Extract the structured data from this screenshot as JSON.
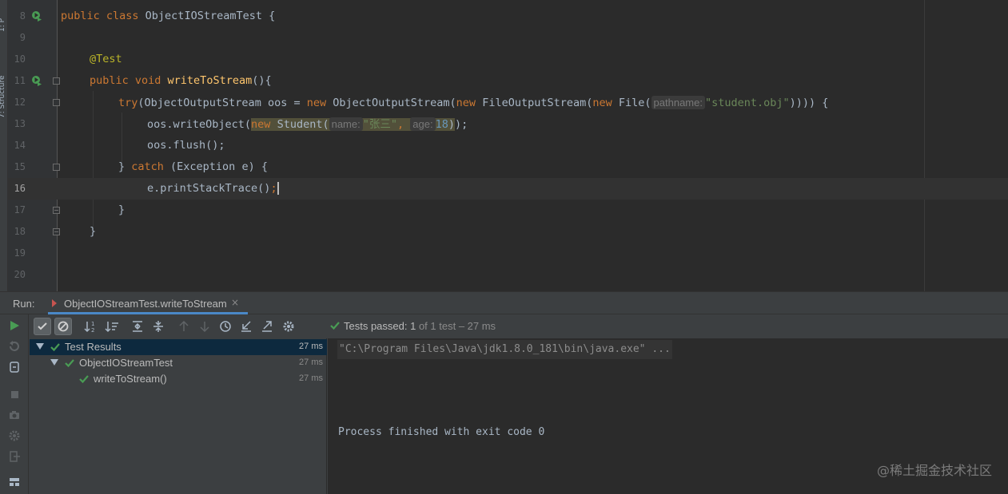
{
  "side_strip": {
    "labels": [
      "1: P",
      "7: Structure"
    ]
  },
  "editor": {
    "lines": [
      {
        "num": "8"
      },
      {
        "num": "9"
      },
      {
        "num": "10"
      },
      {
        "num": "11"
      },
      {
        "num": "12"
      },
      {
        "num": "13"
      },
      {
        "num": "14"
      },
      {
        "num": "15"
      },
      {
        "num": "16"
      },
      {
        "num": "17"
      },
      {
        "num": "18"
      },
      {
        "num": "19"
      },
      {
        "num": "20"
      }
    ],
    "tokens": {
      "l8_kw": "public class ",
      "l8_rest": "ObjectIOStreamTest {",
      "l10_anno": "@Test",
      "l11_kw": "public void ",
      "l11_fn": "writeToStream",
      "l11_rest": "(){",
      "l12_try": "try",
      "l12_a": "(ObjectOutputStream oos = ",
      "l12_new1": "new",
      "l12_b": " ObjectOutputStream(",
      "l12_new2": "new",
      "l12_c": " FileOutputStream(",
      "l12_new3": "new",
      "l12_d": " File(",
      "l12_hint": "pathname:",
      "l12_str": "\"student.obj\"",
      "l12_end": ")))) {",
      "l13_a": "oos.writeObject(",
      "l13_new": "new",
      "l13_b": " Student(",
      "l13_hint1": "name:",
      "l13_str": "\"张三\"",
      "l13_comma": ",",
      "l13_hint2": "age:",
      "l13_num": "18",
      "l13_end": "));",
      "l14": "oos.flush();",
      "l15_a": "} ",
      "l15_catch": "catch",
      "l15_b": " (Exception e) {",
      "l16_a": "e.printStackTrace()",
      "l16_semi": ";",
      "l17": "}",
      "l18": "}"
    }
  },
  "run_panel": {
    "run_label": "Run:",
    "tab_label": "ObjectIOStreamTest.writeToStream",
    "tab_close": "×",
    "status_prefix": "Tests passed: ",
    "status_passed": "1",
    "status_of": " of 1 test – 27 ms",
    "tree": [
      {
        "label": "Test Results",
        "time": "27 ms"
      },
      {
        "label": "ObjectIOStreamTest",
        "time": "27 ms"
      },
      {
        "label": "writeToStream()",
        "time": "27 ms"
      }
    ],
    "console": {
      "command": "\"C:\\Program Files\\Java\\jdk1.8.0_181\\bin\\java.exe\" ...",
      "exit_line": "Process finished with exit code 0"
    }
  },
  "watermark": "@稀土掘金技术社区",
  "colors": {
    "background": "#2b2b2b",
    "keyword": "#cc7832",
    "method": "#ffc66d",
    "annotation": "#bbb529",
    "string": "#6a8759",
    "number": "#6897bb",
    "pass_green": "#499c54",
    "tab_underline": "#4a88c7"
  }
}
